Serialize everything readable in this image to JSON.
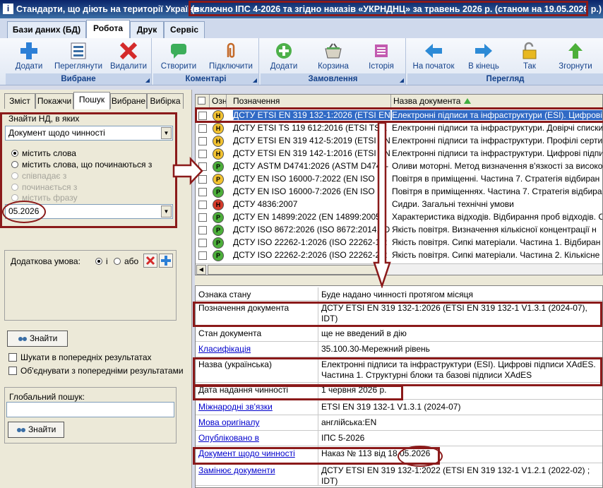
{
  "window": {
    "title_main": "Стандарти, що діють на території України",
    "title_extra": "(включно ІПС 4-2026  та згідно наказів «УКРНДНЦ» за травень 2026 р. (станом  на 19.05.2026 р.)"
  },
  "menu_tabs": [
    "Бази даних (БД)",
    "Робота",
    "Друк",
    "Сервіс"
  ],
  "ribbon": {
    "groups": [
      {
        "title": "Вибране",
        "buttons": [
          "Додати",
          "Переглянути",
          "Видалити"
        ]
      },
      {
        "title": "Коментарі",
        "buttons": [
          "Створити",
          "Підключити"
        ]
      },
      {
        "title": "Замовлення",
        "buttons": [
          "Додати",
          "Корзина",
          "Історія"
        ]
      },
      {
        "title": "Перегляд",
        "buttons": [
          "На початок",
          "В кінець",
          "Так",
          "Згорнути"
        ]
      }
    ]
  },
  "left": {
    "tabs": [
      "Зміст",
      "Покажчи",
      "Пошук",
      "Вибране",
      "Вибірка"
    ],
    "find_label": "Знайти НД, в яких",
    "doc_field_value": "Документ щодо чинності",
    "radios": [
      {
        "label": "містить слова",
        "selected": true,
        "enabled": true
      },
      {
        "label": "містить слова, що починаються з",
        "selected": false,
        "enabled": true
      },
      {
        "label": "співпадає з",
        "selected": false,
        "enabled": false
      },
      {
        "label": "починається з",
        "selected": false,
        "enabled": false
      },
      {
        "label": "містить фразу",
        "selected": false,
        "enabled": false
      }
    ],
    "search_value": "05.2026",
    "extra_condition_label": "Додаткова умова:",
    "and_label": "і",
    "or_label": "або",
    "find_button": "Знайти",
    "checkbox_prev": "Шукати в попередніх результатах",
    "checkbox_merge": "Об'єднувати з попередніми результатами",
    "global_label": "Глобальний пошук:",
    "global_value": "",
    "global_find_button": "Знайти"
  },
  "grid": {
    "headers": [
      "",
      "Озн",
      "Позначення",
      "Назва документа"
    ],
    "rows": [
      {
        "status": "Н",
        "color": "#f2c230",
        "designation": "ДСТУ ETSI EN 319 132-1:2026 (ETSI EN",
        "name": "Електронні підписи та інфраструктури (ESI). Цифрові",
        "selected": true
      },
      {
        "status": "Н",
        "color": "#f2c230",
        "designation": "ДСТУ ETSI TS 119 612:2016 (ETSI TS 1",
        "name": "Електронні підписи та інфраструктури. Довірчі списки",
        "selected": false
      },
      {
        "status": "Н",
        "color": "#f2c230",
        "designation": "ДСТУ ETSI EN 319 412-5:2019 (ETSI EN",
        "name": "Електронні підписи та інфраструктури. Профілі серти",
        "selected": false
      },
      {
        "status": "Н",
        "color": "#f2c230",
        "designation": "ДСТУ ETSI EN 319 142-1:2016 (ETSI EN",
        "name": "Електронні підписи та інфраструктури. Цифрові підпи",
        "selected": false
      },
      {
        "status": "Р",
        "color": "#4caf3a",
        "designation": "ДСТУ ASTM D4741:2026 (ASTM D4741-",
        "name": "Оливи моторні. Метод визначення в'язкості за високо",
        "selected": false
      },
      {
        "status": "Р",
        "color": "#f2c230",
        "designation": "ДСТУ EN ISO 16000-7:2022 (EN ISO 16",
        "name": "Повітря в приміщенні. Частина 7. Стратегія відбиран",
        "selected": false
      },
      {
        "status": "Р",
        "color": "#4caf3a",
        "designation": "ДСТУ EN ISO 16000-7:2026 (EN ISO 16",
        "name": "Повітря в приміщеннях. Частина 7. Стратегія відбира",
        "selected": false
      },
      {
        "status": "Н",
        "color": "#d63a2a",
        "designation": "ДСТУ 4836:2007",
        "name": "Сидри. Загальні технічні умови",
        "selected": false
      },
      {
        "status": "Р",
        "color": "#4caf3a",
        "designation": "ДСТУ EN 14899:2022 (EN 14899:2005,",
        "name": "Характеристика відходів. Відбирання проб відходів. С",
        "selected": false
      },
      {
        "status": "Р",
        "color": "#4caf3a",
        "designation": "ДСТУ ISO 8672:2026 (ISO 8672:2014, ID",
        "name": "Якість повітря. Визначення кількісної концентрації н",
        "selected": false
      },
      {
        "status": "Р",
        "color": "#4caf3a",
        "designation": "ДСТУ ISO 22262-1:2026 (ISO 22262-1:2",
        "name": "Якість повітря. Сипкі матеріали. Частина 1. Відбиран",
        "selected": false
      },
      {
        "status": "Р",
        "color": "#4caf3a",
        "designation": "ДСТУ ISO 22262-2:2026 (ISO 22262-2:2",
        "name": "Якість повітря. Сипкі матеріали. Частина 2. Кількісне",
        "selected": false
      }
    ]
  },
  "details": [
    {
      "label": "Ознака стану",
      "value": "Буде надано чинності протягом місяця",
      "link": false
    },
    {
      "label": "Позначення документа",
      "value": "ДСТУ ETSI EN 319 132-1:2026 (ETSI EN 319 132-1 V1.3.1 (2024-07), IDT)",
      "link": false
    },
    {
      "label": "Стан документа",
      "value": "ще не введений в дію",
      "link": false
    },
    {
      "label": "Класифікація",
      "value": "35.100.30-Мережний рівень",
      "link": true
    },
    {
      "label": "Назва (українська)",
      "value": "Електронні підписи та інфраструктури (ESI). Цифрові підписи XAdES. Частина 1. Структурні блоки та базові підписи XAdES",
      "link": false
    },
    {
      "label": "Дата надання чинності",
      "value": "1 червня 2026 р.",
      "link": false
    },
    {
      "label": "Міжнародні зв'язки",
      "value": "ETSI EN 319 132-1 V1.3.1 (2024-07)",
      "link": true
    },
    {
      "label": "Мова оригіналу",
      "value": "англійська:EN",
      "link": true
    },
    {
      "label": "Опубліковано в",
      "value": "ІПС 5-2026",
      "link": true
    },
    {
      "label": "Документ щодо чинності",
      "value": "Наказ № 113 від 18.05.2026",
      "link": true
    },
    {
      "label": "Замінює документи",
      "value": "ДСТУ ETSI EN 319 132-1:2022 (ETSI EN 319 132-1 V1.2.1 (2022-02) ; IDT)",
      "link": true
    }
  ]
}
